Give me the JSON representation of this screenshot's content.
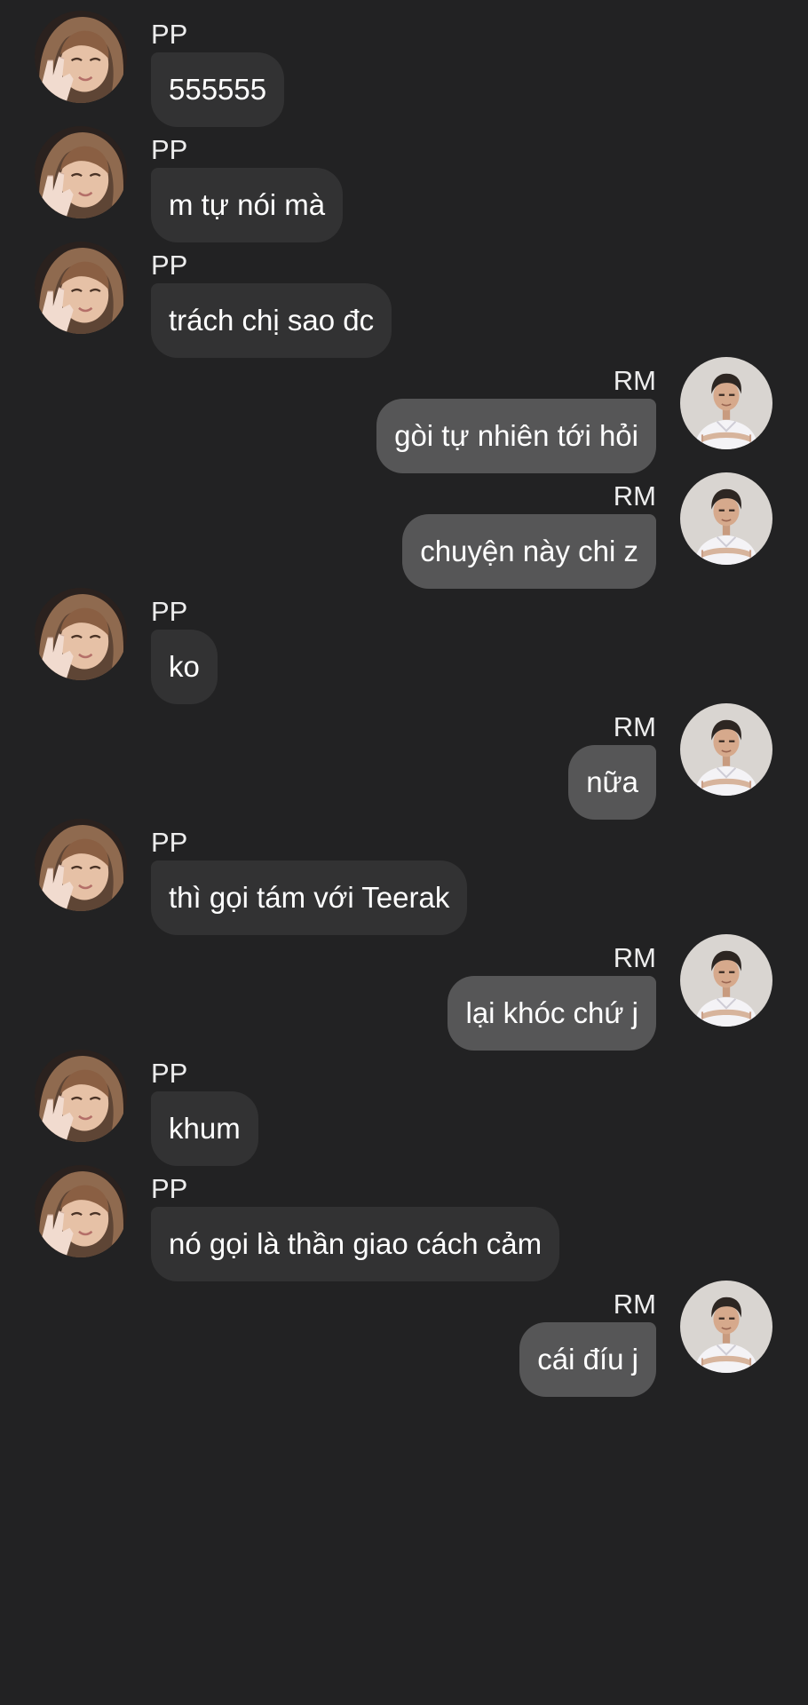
{
  "conversation": {
    "messages": [
      {
        "sender": "PP",
        "side": "left",
        "text": "555555",
        "avatar": "pp-avatar"
      },
      {
        "sender": "PP",
        "side": "left",
        "text": "m tự nói mà",
        "avatar": "pp-avatar"
      },
      {
        "sender": "PP",
        "side": "left",
        "text": "trách chị sao đc",
        "avatar": "pp-avatar"
      },
      {
        "sender": "RM",
        "side": "right",
        "text": "gòi tự nhiên tới hỏi",
        "avatar": "rm-avatar"
      },
      {
        "sender": "RM",
        "side": "right",
        "text": "chuyện này chi z",
        "avatar": "rm-avatar"
      },
      {
        "sender": "PP",
        "side": "left",
        "text": "ko",
        "avatar": "pp-avatar"
      },
      {
        "sender": "RM",
        "side": "right",
        "text": "nữa",
        "avatar": "rm-avatar"
      },
      {
        "sender": "PP",
        "side": "left",
        "text": "thì gọi tám với Teerak",
        "avatar": "pp-avatar"
      },
      {
        "sender": "RM",
        "side": "right",
        "text": "lại khóc chứ j",
        "avatar": "rm-avatar"
      },
      {
        "sender": "PP",
        "side": "left",
        "text": "khum",
        "avatar": "pp-avatar"
      },
      {
        "sender": "PP",
        "side": "left",
        "text": "nó gọi là thần giao cách cảm",
        "avatar": "pp-avatar"
      },
      {
        "sender": "RM",
        "side": "right",
        "text": "cái đíu j",
        "avatar": "rm-avatar"
      }
    ]
  },
  "colors": {
    "background": "#222223",
    "incoming_bubble": "#323233",
    "outgoing_bubble": "#565657",
    "text": "#ffffff"
  }
}
